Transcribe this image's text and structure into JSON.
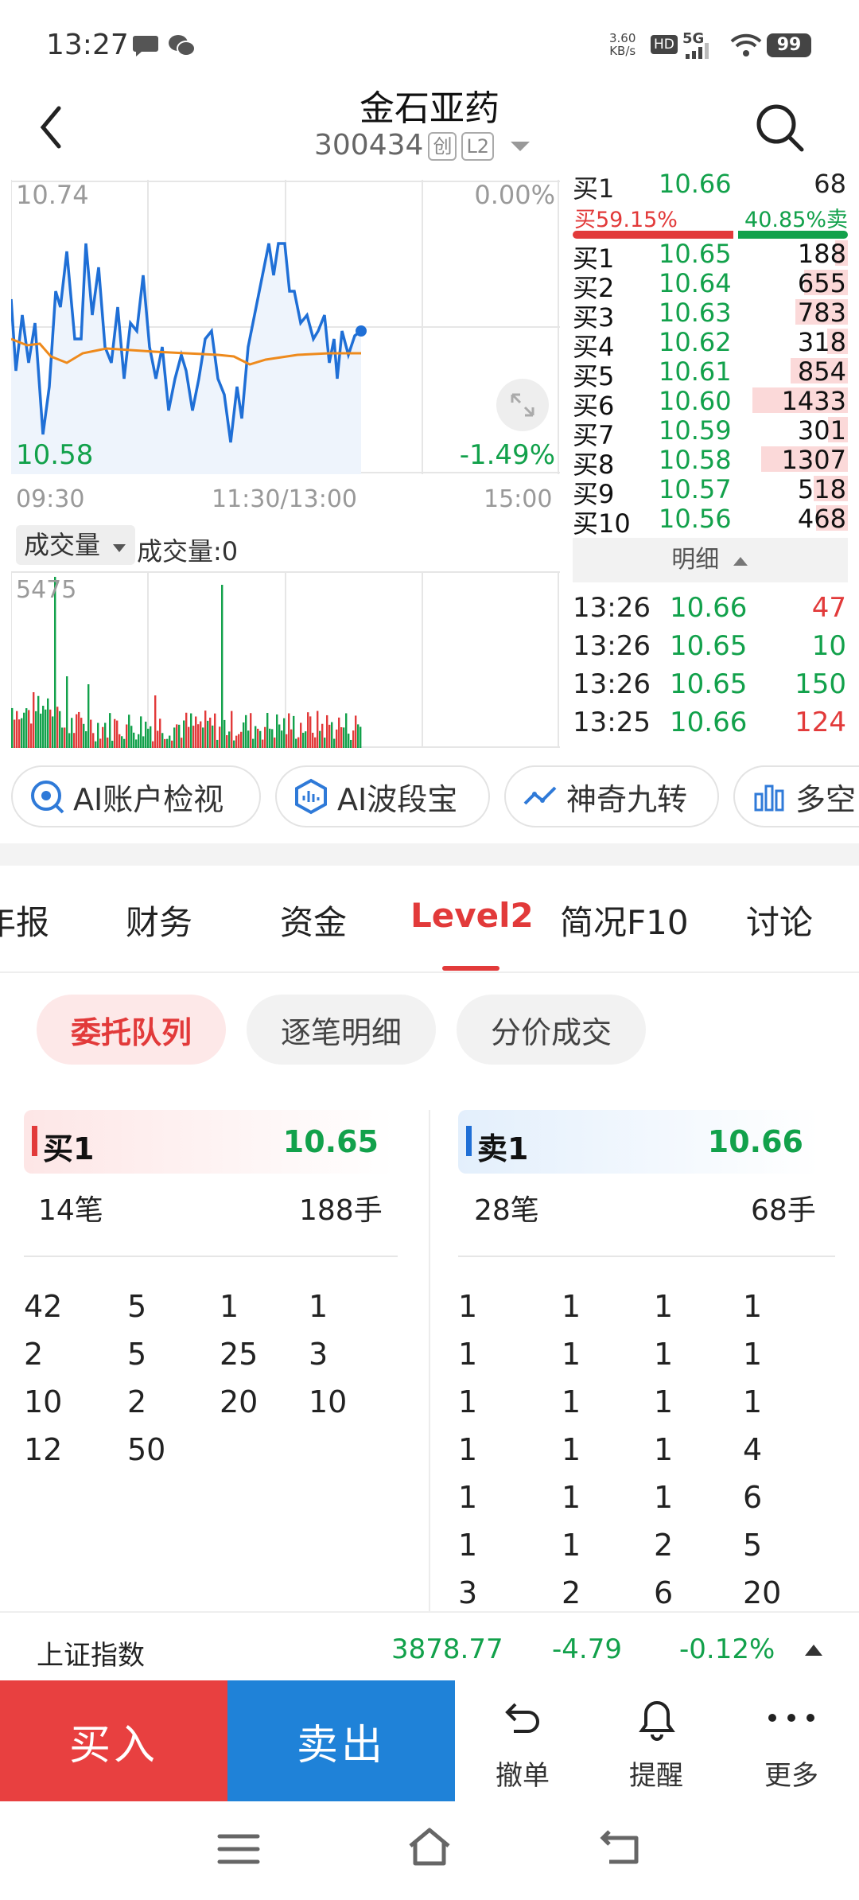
{
  "status": {
    "time": "13:27",
    "net_speed": "3.60",
    "net_unit": "KB/s",
    "hd": "HD",
    "signal": "5G",
    "battery": "99"
  },
  "header": {
    "title": "金石亚药",
    "code": "300434",
    "badge1": "创",
    "badge2": "L2"
  },
  "chart": {
    "price_high": "10.74",
    "price_low": "10.58",
    "pct_high": "0.00%",
    "pct_low": "-1.49%",
    "time_start": "09:30",
    "time_mid": "11:30/13:00",
    "time_end": "15:00",
    "vol_selector": "成交量",
    "vol_value": "成交量:0",
    "vol_max": "5475"
  },
  "depth": {
    "top_partial": {
      "label": "买1",
      "price": "10.66",
      "vol": "68"
    },
    "buy_ratio": "买59.15%",
    "sell_ratio": "40.85%卖",
    "buy_ratio_value": 59.15,
    "levels": [
      {
        "label": "买1",
        "price": "10.65",
        "vol": "188",
        "bar": 0.13
      },
      {
        "label": "买2",
        "price": "10.64",
        "vol": "655",
        "bar": 0.46
      },
      {
        "label": "买3",
        "price": "10.63",
        "vol": "783",
        "bar": 0.55
      },
      {
        "label": "买4",
        "price": "10.62",
        "vol": "318",
        "bar": 0.22
      },
      {
        "label": "买5",
        "price": "10.61",
        "vol": "854",
        "bar": 0.6
      },
      {
        "label": "买6",
        "price": "10.60",
        "vol": "1433",
        "bar": 1.0
      },
      {
        "label": "买7",
        "price": "10.59",
        "vol": "301",
        "bar": 0.21
      },
      {
        "label": "买8",
        "price": "10.58",
        "vol": "1307",
        "bar": 0.91
      },
      {
        "label": "买9",
        "price": "10.57",
        "vol": "518",
        "bar": 0.36
      },
      {
        "label": "买10",
        "price": "10.56",
        "vol": "468",
        "bar": 0.33
      }
    ],
    "detail_label": "明细",
    "ticks": [
      {
        "time": "13:26",
        "price": "10.66",
        "vol": "47",
        "dir": "up"
      },
      {
        "time": "13:26",
        "price": "10.65",
        "vol": "10",
        "dir": "down"
      },
      {
        "time": "13:26",
        "price": "10.65",
        "vol": "150",
        "dir": "down"
      },
      {
        "time": "13:25",
        "price": "10.66",
        "vol": "124",
        "dir": "up"
      }
    ]
  },
  "tools": [
    "AI账户检视",
    "AI波段宝",
    "神奇九转",
    "多空"
  ],
  "tabs": [
    "年报",
    "财务",
    "资金",
    "Level2",
    "简况F10",
    "讨论"
  ],
  "segments": [
    "委托队列",
    "逐笔明细",
    "分价成交"
  ],
  "queue": {
    "buy": {
      "label": "买1",
      "price": "10.65",
      "orders": "14笔",
      "hands": "188手",
      "cells": [
        "42",
        "5",
        "1",
        "1",
        "2",
        "5",
        "25",
        "3",
        "10",
        "2",
        "20",
        "10",
        "12",
        "50"
      ]
    },
    "sell": {
      "label": "卖1",
      "price": "10.66",
      "orders": "28笔",
      "hands": "68手",
      "cells": [
        "1",
        "1",
        "1",
        "1",
        "1",
        "1",
        "1",
        "1",
        "1",
        "1",
        "1",
        "1",
        "1",
        "1",
        "1",
        "4",
        "1",
        "1",
        "1",
        "6",
        "1",
        "1",
        "2",
        "5",
        "3",
        "2",
        "6",
        "20"
      ]
    }
  },
  "index": {
    "name": "上证指数",
    "value": "3878.77",
    "change": "-4.79",
    "pct": "-0.12%"
  },
  "trade": {
    "buy": "买入",
    "sell": "卖出",
    "cancel": "撤单",
    "alert": "提醒",
    "more": "更多"
  },
  "colors": {
    "red": "#e23a3a",
    "green": "#12a14b",
    "blue": "#1f82d8"
  }
}
